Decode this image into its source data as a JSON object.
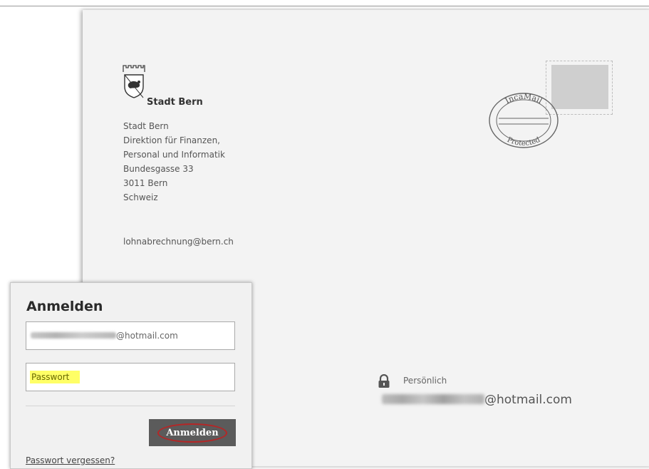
{
  "sender": {
    "logo_name": "Stadt Bern",
    "address_lines": [
      "Stadt Bern",
      "Direktion für Finanzen,",
      "Personal und Informatik",
      "Bundesgasse 33",
      "3011 Bern",
      "Schweiz"
    ],
    "email": "lohnabrechnung@bern.ch"
  },
  "stamp": {
    "seal_top_text": "IncaMail",
    "seal_bottom_text": "Protected"
  },
  "recipient": {
    "label": "Persönlich",
    "email_domain": "@hotmail.com"
  },
  "login": {
    "title": "Anmelden",
    "email_domain": "@hotmail.com",
    "password_placeholder": "Passwort",
    "button_label": "Anmelden",
    "forgot_link": "Passwort vergessen?"
  },
  "colors": {
    "envelope": "#f3f3f3",
    "button": "#5b5b5b",
    "button_circle": "#b52626",
    "password_highlight": "#ffff66"
  }
}
